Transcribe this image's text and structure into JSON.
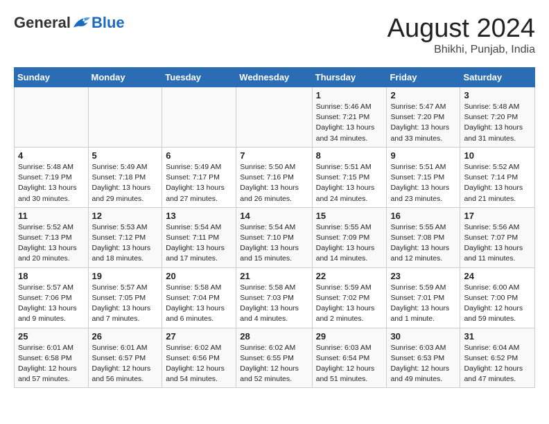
{
  "header": {
    "logo_general": "General",
    "logo_blue": "Blue",
    "month_title": "August 2024",
    "location": "Bhikhi, Punjab, India"
  },
  "weekdays": [
    "Sunday",
    "Monday",
    "Tuesday",
    "Wednesday",
    "Thursday",
    "Friday",
    "Saturday"
  ],
  "weeks": [
    [
      {
        "day": "",
        "content": ""
      },
      {
        "day": "",
        "content": ""
      },
      {
        "day": "",
        "content": ""
      },
      {
        "day": "",
        "content": ""
      },
      {
        "day": "1",
        "content": "Sunrise: 5:46 AM\nSunset: 7:21 PM\nDaylight: 13 hours\nand 34 minutes."
      },
      {
        "day": "2",
        "content": "Sunrise: 5:47 AM\nSunset: 7:20 PM\nDaylight: 13 hours\nand 33 minutes."
      },
      {
        "day": "3",
        "content": "Sunrise: 5:48 AM\nSunset: 7:20 PM\nDaylight: 13 hours\nand 31 minutes."
      }
    ],
    [
      {
        "day": "4",
        "content": "Sunrise: 5:48 AM\nSunset: 7:19 PM\nDaylight: 13 hours\nand 30 minutes."
      },
      {
        "day": "5",
        "content": "Sunrise: 5:49 AM\nSunset: 7:18 PM\nDaylight: 13 hours\nand 29 minutes."
      },
      {
        "day": "6",
        "content": "Sunrise: 5:49 AM\nSunset: 7:17 PM\nDaylight: 13 hours\nand 27 minutes."
      },
      {
        "day": "7",
        "content": "Sunrise: 5:50 AM\nSunset: 7:16 PM\nDaylight: 13 hours\nand 26 minutes."
      },
      {
        "day": "8",
        "content": "Sunrise: 5:51 AM\nSunset: 7:15 PM\nDaylight: 13 hours\nand 24 minutes."
      },
      {
        "day": "9",
        "content": "Sunrise: 5:51 AM\nSunset: 7:15 PM\nDaylight: 13 hours\nand 23 minutes."
      },
      {
        "day": "10",
        "content": "Sunrise: 5:52 AM\nSunset: 7:14 PM\nDaylight: 13 hours\nand 21 minutes."
      }
    ],
    [
      {
        "day": "11",
        "content": "Sunrise: 5:52 AM\nSunset: 7:13 PM\nDaylight: 13 hours\nand 20 minutes."
      },
      {
        "day": "12",
        "content": "Sunrise: 5:53 AM\nSunset: 7:12 PM\nDaylight: 13 hours\nand 18 minutes."
      },
      {
        "day": "13",
        "content": "Sunrise: 5:54 AM\nSunset: 7:11 PM\nDaylight: 13 hours\nand 17 minutes."
      },
      {
        "day": "14",
        "content": "Sunrise: 5:54 AM\nSunset: 7:10 PM\nDaylight: 13 hours\nand 15 minutes."
      },
      {
        "day": "15",
        "content": "Sunrise: 5:55 AM\nSunset: 7:09 PM\nDaylight: 13 hours\nand 14 minutes."
      },
      {
        "day": "16",
        "content": "Sunrise: 5:55 AM\nSunset: 7:08 PM\nDaylight: 13 hours\nand 12 minutes."
      },
      {
        "day": "17",
        "content": "Sunrise: 5:56 AM\nSunset: 7:07 PM\nDaylight: 13 hours\nand 11 minutes."
      }
    ],
    [
      {
        "day": "18",
        "content": "Sunrise: 5:57 AM\nSunset: 7:06 PM\nDaylight: 13 hours\nand 9 minutes."
      },
      {
        "day": "19",
        "content": "Sunrise: 5:57 AM\nSunset: 7:05 PM\nDaylight: 13 hours\nand 7 minutes."
      },
      {
        "day": "20",
        "content": "Sunrise: 5:58 AM\nSunset: 7:04 PM\nDaylight: 13 hours\nand 6 minutes."
      },
      {
        "day": "21",
        "content": "Sunrise: 5:58 AM\nSunset: 7:03 PM\nDaylight: 13 hours\nand 4 minutes."
      },
      {
        "day": "22",
        "content": "Sunrise: 5:59 AM\nSunset: 7:02 PM\nDaylight: 13 hours\nand 2 minutes."
      },
      {
        "day": "23",
        "content": "Sunrise: 5:59 AM\nSunset: 7:01 PM\nDaylight: 13 hours\nand 1 minute."
      },
      {
        "day": "24",
        "content": "Sunrise: 6:00 AM\nSunset: 7:00 PM\nDaylight: 12 hours\nand 59 minutes."
      }
    ],
    [
      {
        "day": "25",
        "content": "Sunrise: 6:01 AM\nSunset: 6:58 PM\nDaylight: 12 hours\nand 57 minutes."
      },
      {
        "day": "26",
        "content": "Sunrise: 6:01 AM\nSunset: 6:57 PM\nDaylight: 12 hours\nand 56 minutes."
      },
      {
        "day": "27",
        "content": "Sunrise: 6:02 AM\nSunset: 6:56 PM\nDaylight: 12 hours\nand 54 minutes."
      },
      {
        "day": "28",
        "content": "Sunrise: 6:02 AM\nSunset: 6:55 PM\nDaylight: 12 hours\nand 52 minutes."
      },
      {
        "day": "29",
        "content": "Sunrise: 6:03 AM\nSunset: 6:54 PM\nDaylight: 12 hours\nand 51 minutes."
      },
      {
        "day": "30",
        "content": "Sunrise: 6:03 AM\nSunset: 6:53 PM\nDaylight: 12 hours\nand 49 minutes."
      },
      {
        "day": "31",
        "content": "Sunrise: 6:04 AM\nSunset: 6:52 PM\nDaylight: 12 hours\nand 47 minutes."
      }
    ]
  ]
}
